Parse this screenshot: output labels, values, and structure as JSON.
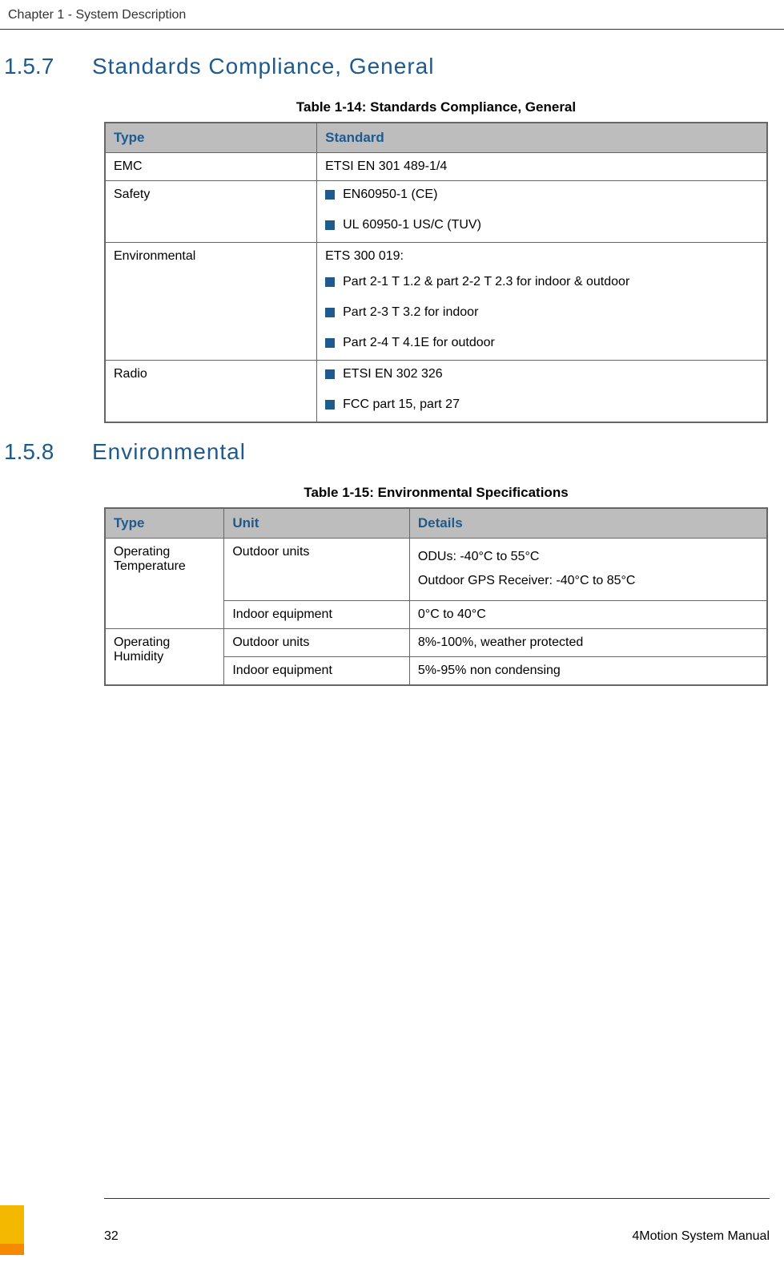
{
  "header": {
    "chapter": "Chapter 1 - System Description"
  },
  "section1": {
    "num": "1.5.7",
    "title": "Standards Compliance, General"
  },
  "table14": {
    "caption": "Table 1-14: Standards Compliance, General",
    "headers": {
      "type": "Type",
      "standard": "Standard"
    },
    "rows": {
      "emc": {
        "type": "EMC",
        "standard": "ETSI EN 301 489-1/4"
      },
      "safety": {
        "type": "Safety",
        "items": {
          "a": "EN60950-1 (CE)",
          "b": "UL 60950-1 US/C (TUV)"
        }
      },
      "env": {
        "type": "Environmental",
        "intro": "ETS 300 019:",
        "items": {
          "a": "Part 2-1 T 1.2 & part 2-2 T 2.3 for indoor & outdoor",
          "b": "Part 2-3 T 3.2 for indoor",
          "c": "Part 2-4 T 4.1E for outdoor"
        }
      },
      "radio": {
        "type": "Radio",
        "items": {
          "a": "ETSI EN 302 326",
          "b": "FCC part 15, part 27"
        }
      }
    }
  },
  "section2": {
    "num": "1.5.8",
    "title": "Environmental"
  },
  "table15": {
    "caption": "Table 1-15: Environmental Specifications",
    "headers": {
      "type": "Type",
      "unit": "Unit",
      "details": "Details"
    },
    "rows": {
      "optemp": {
        "type": "Operating Temperature",
        "r1": {
          "unit": "Outdoor units",
          "d1": "ODUs: -40°C to 55°C",
          "d2": "Outdoor GPS Receiver: -40°C to 85°C"
        },
        "r2": {
          "unit": "Indoor equipment",
          "details": "0°C to 40°C"
        }
      },
      "ophum": {
        "type": "Operating Humidity",
        "r1": {
          "unit": "Outdoor units",
          "details": "8%-100%, weather protected"
        },
        "r2": {
          "unit": "Indoor equipment",
          "details": "5%-95% non condensing"
        }
      }
    }
  },
  "footer": {
    "page": "32",
    "manual": "4Motion System Manual"
  }
}
